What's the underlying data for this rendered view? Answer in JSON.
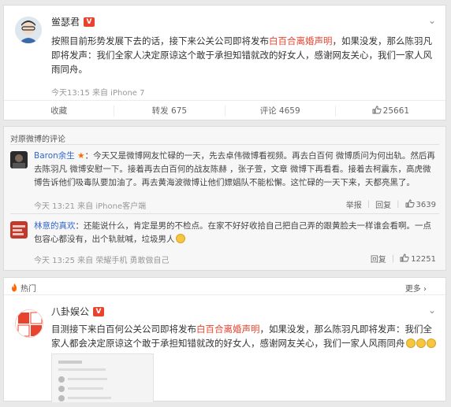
{
  "post": {
    "author": "鲎瑟君",
    "verified_label": "V",
    "text_before": "按照目前形势发展下去的话，接下来公关公司即将发布",
    "text_highlight": "白百合离婚声明",
    "text_after": "，如果没发，那么陈羽凡即将发声：我们全家人决定原谅这个敢于承担知错就改的好女人，感谢网友关心，我们一家人风雨同舟。",
    "meta": "今天13:15 来自 iPhone 7",
    "actions": {
      "favorite": "收藏",
      "repost": "转发 675",
      "comment": "评论 4659",
      "like": "25661"
    }
  },
  "comments_section": {
    "header": "对原微博的评论",
    "items": [
      {
        "name": "Baron余生",
        "star": "★",
        "text": "：今天又是微博网友忙碌的一天，先去卓伟微博看视频。再去白百何 微博质问为何出轨。然后再去陈羽凡 微博安慰一下。接着再去白百何的战友陈赫 ，张子萱，文章 微博下再看看。接着去柯震东，高虎微博告诉他们吸毒队要加油了。再去黄海波微博让他们嫖娼队不能松懈。这忙碌的一天下来，天都亮黑了。",
        "meta": "今天 13:21 来自 iPhone客户端",
        "report": "举报",
        "reply": "回复",
        "likes": "3639"
      },
      {
        "name": "林意的真欢",
        "text": "：还能说什么，肯定是男的不检点。在家不好好收拾自己把自己弄的跟黄脸夫一样谁会看啊。一点包容心都没有，出个轨就喊，垃圾男人",
        "meta": "今天 13:25 来自 荣耀手机 勇敢做自己",
        "reply": "回复",
        "likes": "12251"
      }
    ]
  },
  "hot": {
    "label": "热门",
    "more": "更多 ›"
  },
  "post2": {
    "author": "八卦娱公",
    "verified_label": "V",
    "avatar_text": "八卦娱公",
    "text_before": "目测接下来白百何公关公司即将发布",
    "text_highlight": "白百合离婚声明",
    "text_after": "，如果没发，那么陈羽凡即将发声：我们全家人都会决定原谅这个敢于承担知错就改的好女人，感谢网友关心，我们一家人风雨同舟"
  },
  "colors": {
    "accent_red": "#e8432e",
    "link_blue": "#3366cc",
    "star_orange": "#ff6600"
  },
  "icons": [
    "chevron-down-icon",
    "like-icon",
    "flame-icon",
    "emoji-laugh-icon",
    "verified-icon"
  ]
}
